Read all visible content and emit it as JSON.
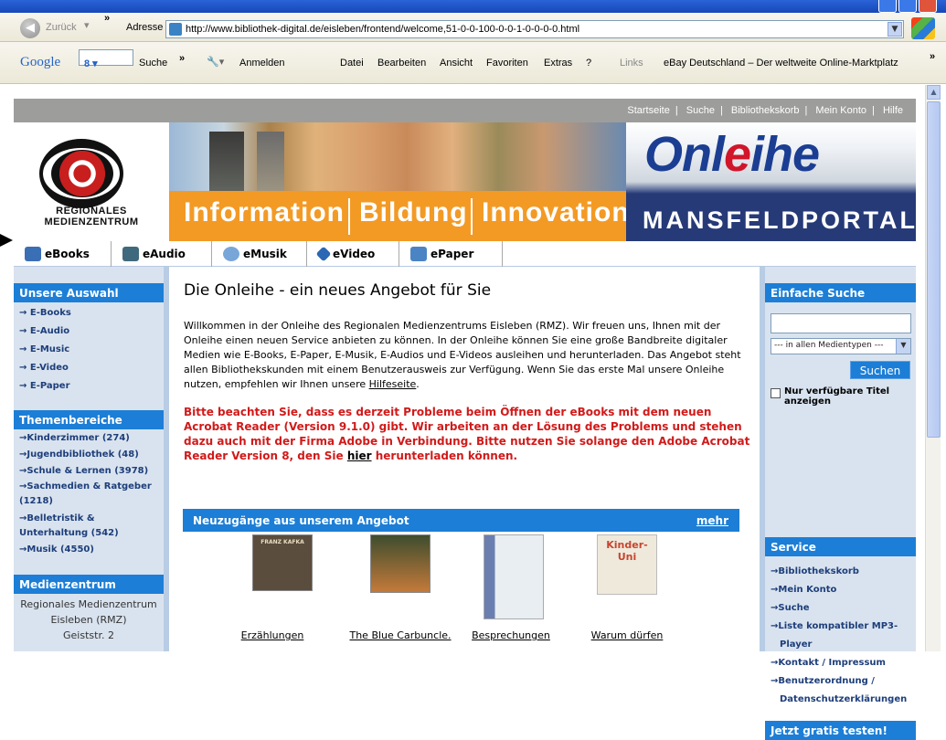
{
  "browser": {
    "back_label": "Zurück",
    "address_label": "Adresse",
    "url": "http://www.bibliothek-digital.de/eisleben/frontend/welcome,51-0-0-100-0-0-1-0-0-0-0.html",
    "google_label": "Google",
    "google_search_label": "Suche",
    "signin_label": "Anmelden",
    "menu": [
      "Datei",
      "Bearbeiten",
      "Ansicht",
      "Favoriten",
      "Extras",
      "?"
    ],
    "links_label": "Links",
    "ebay_link": "eBay Deutschland – Der weltweite Online-Marktplatz"
  },
  "topnav": [
    "Startseite",
    "Suche",
    "Bibliothekskorb",
    "Mein Konto",
    "Hilfe"
  ],
  "banner": {
    "rmz_line1": "REGIONALES",
    "rmz_line2": "MEDIENZENTRUM",
    "words": [
      "Information",
      "Bildung",
      "Innovation"
    ],
    "onleihe_pre": "Onl",
    "onleihe_e": "e",
    "onleihe_post": "ihe",
    "portal": "MANSFELDPORTAL"
  },
  "media_tabs": [
    {
      "label": "eBooks",
      "color": "#3a6fb6"
    },
    {
      "label": "eAudio",
      "color": "#3f6a7e"
    },
    {
      "label": "eMusik",
      "color": "#78a6d8"
    },
    {
      "label": "eVideo",
      "color": "#2a67b5"
    },
    {
      "label": "ePaper",
      "color": "#4b84c4"
    }
  ],
  "left": {
    "auswahl_title": "Unsere Auswahl",
    "auswahl": [
      "→ E-Books",
      "→ E-Audio",
      "→ E-Music",
      "→ E-Video",
      "→ E-Paper"
    ],
    "themen_title": "Themenbereiche",
    "themen": [
      "→Kinderzimmer (274)",
      "→Jugendbibliothek (48)",
      "→Schule & Lernen (3978)",
      "→Sachmedien & Ratgeber (1218)",
      "→Belletristik & Unterhaltung (542)",
      "→Musik (4550)"
    ],
    "medien_title": "Medienzentrum",
    "address": [
      "Regionales Medienzentrum",
      "Eisleben (RMZ)",
      "Geiststr. 2"
    ]
  },
  "main": {
    "title": "Die Onleihe - ein neues Angebot für Sie",
    "intro": "Willkommen in der Onleihe des Regionalen Medienzentrums Eisleben (RMZ). Wir freuen uns, Ihnen mit der Onleihe einen neuen Service anbieten zu können. In der Onleihe können Sie eine große Bandbreite digitaler Medien wie E-Books, E-Paper, E-Musik, E-Audios und E-Videos ausleihen und herunterladen. Das Angebot steht allen Bibliothekskunden mit einem Benutzerausweis zur Verfügung. Wenn Sie das erste Mal unsere Onleihe nutzen, empfehlen wir Ihnen unsere ",
    "hilfe_link": "Hilfeseite",
    "intro_end": ".",
    "warning": "Bitte beachten Sie, dass es derzeit Probleme beim Öffnen der eBooks mit dem neuen Acrobat Reader (Version 9.1.0) gibt. Wir arbeiten an der Lösung des Problems und stehen dazu auch mit der Firma Adobe in Verbindung. Bitte nutzen Sie solange den Adobe Acrobat Reader Version 8, den Sie ",
    "warning_link": "hier",
    "warning_end": " herunterladen können.",
    "new_title": "Neuzugänge aus unserem Angebot",
    "more": "mehr",
    "books": [
      {
        "title": "Erzählungen",
        "cover_text": "FRANZ KAFKA",
        "cover_color": "#5a4d3e",
        "accent": "#9b8b6b"
      },
      {
        "title": "The Blue Carbuncle. The Painful",
        "cover_text": "",
        "cover_color": "#3e4d2e",
        "accent": "#c47a3a"
      },
      {
        "title": "Besprechungen sicher und sinnvoll",
        "cover_text": "",
        "cover_color": "#e9eef2",
        "accent": "#6a7fb0"
      },
      {
        "title": "Warum dürfen Erwachsene mehr",
        "cover_text": "Kinder-Uni",
        "cover_color": "#efe9dc",
        "accent": "#c8452e"
      }
    ]
  },
  "right": {
    "search_title": "Einfache Suche",
    "search_value": "",
    "select_value": "--- in allen Medientypen ---",
    "search_button": "Suchen",
    "only_available": "Nur verfügbare Titel anzeigen",
    "service_title": "Service",
    "service": [
      "→Bibliothekskorb",
      "→Mein Konto",
      "→Suche",
      "→Liste kompatibler MP3-",
      "Player",
      "→Kontakt / Impressum",
      "→Benutzerordnung /",
      "Datenschutzerklärungen"
    ],
    "test_title": "Jetzt gratis testen!"
  }
}
